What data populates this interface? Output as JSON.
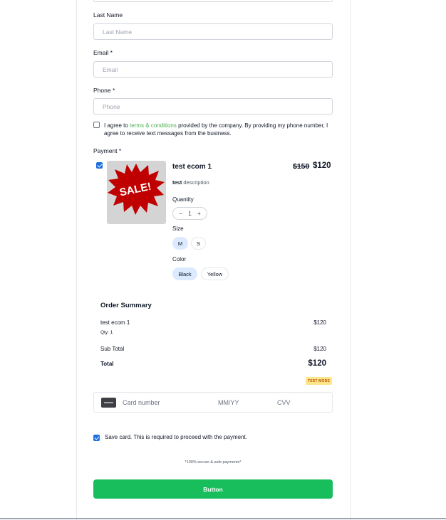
{
  "form": {
    "last_name_label": "Last Name",
    "last_name_placeholder": "Last Name",
    "email_label": "Email *",
    "email_placeholder": "Email",
    "phone_label": "Phone *",
    "phone_placeholder": "Phone",
    "agree_prefix": "I agree to ",
    "agree_link": "terms & conditions",
    "agree_suffix": " provided by the company. By providing my phone number, I agree to receive text messages from the business.",
    "payment_label": "Payment *"
  },
  "product": {
    "image_text": "SALE!",
    "name": "test ecom 1",
    "price_old": "$150",
    "price": "$120",
    "desc_bold": "test",
    "desc_rest": " description",
    "quantity_label": "Quantity",
    "quantity_minus": "−",
    "quantity_value": "1",
    "quantity_plus": "+",
    "size_label": "Size",
    "sizes": [
      "M",
      "S"
    ],
    "color_label": "Color",
    "colors": [
      "Black",
      "Yellow"
    ]
  },
  "order_summary": {
    "title": "Order Summary",
    "item_name": "test ecom 1",
    "item_qty": "Qty: 1",
    "item_price": "$120",
    "subtotal_label": "Sub Total",
    "subtotal_value": "$120",
    "total_label": "Total",
    "total_value": "$120",
    "badge": "TEST MODE"
  },
  "card": {
    "number_placeholder": "Card number",
    "expiry_placeholder": "MM/YY",
    "cvv_placeholder": "CVV"
  },
  "save_card_text": "Save card. This is required to proceed with the payment.",
  "secure_text": "*100% secure & safe payments*",
  "button_label": "Button",
  "colors": {
    "primary_button": "#19be5c",
    "checkbox": "#1d6fe0",
    "link": "#4caf50",
    "badge_bg": "#fde68a"
  }
}
